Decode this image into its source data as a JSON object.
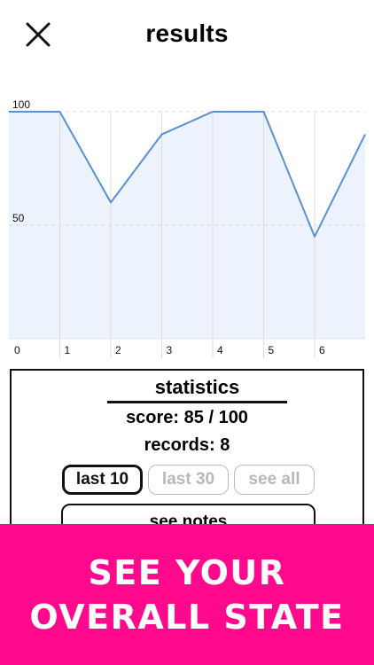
{
  "header": {
    "title": "results",
    "close_icon": "close-icon"
  },
  "chart_data": {
    "type": "area",
    "x": [
      0,
      1,
      2,
      3,
      4,
      5,
      6,
      7
    ],
    "values": [
      100,
      100,
      60,
      90,
      100,
      100,
      45,
      90
    ],
    "xticks": [
      "0",
      "1",
      "2",
      "3",
      "4",
      "5",
      "6"
    ],
    "yticks": [
      "50",
      "100"
    ],
    "ylim": [
      0,
      100
    ],
    "grid": true,
    "line_color": "#5b8fd6",
    "fill_color": "#edf3fd"
  },
  "statistics": {
    "title": "statistics",
    "score": "score: 85 / 100",
    "records": "records: 8",
    "buttons": {
      "last10": "last 10",
      "last30": "last 30",
      "see_all": "see all"
    },
    "notes_button": "see notes"
  },
  "banner": {
    "line1": "SEE YOUR",
    "line2": "OVERALL STATE",
    "background": "#ff0a8c"
  }
}
